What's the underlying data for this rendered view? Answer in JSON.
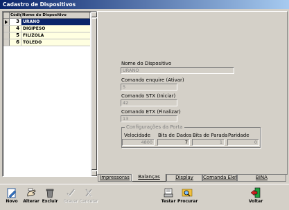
{
  "window": {
    "title": "Cadastro de Dispositivos"
  },
  "grid": {
    "headers": {
      "cod": "Códig",
      "nome": "Nome do Dispositivo"
    },
    "rows": [
      {
        "cod": "3",
        "nome": "URANO"
      },
      {
        "cod": "4",
        "nome": "DIGIPESO"
      },
      {
        "cod": "5",
        "nome": "FILIZOLA"
      },
      {
        "cod": "6",
        "nome": "TOLEDO"
      }
    ]
  },
  "form": {
    "nome_label": "Nome do Dispositivo",
    "nome_value": "URANO",
    "enquire_label": "Comando enquire (Ativar)",
    "enquire_value": "5",
    "stx_label": "Comando STX (Iniciar)",
    "stx_value": "42",
    "etx_label": "Comando ETX (Finalizar)",
    "etx_value": "13",
    "porta": {
      "legend": "Configurações da Porta",
      "velocidade_label": "Velocidade",
      "velocidade_value": "4800",
      "bits_dados_label": "Bits de Dados",
      "bits_dados_value": "7",
      "bits_parada_label": "Bits de Parada",
      "bits_parada_value": "1",
      "paridade_label": "Paridade",
      "paridade_value": "0"
    }
  },
  "tabs": [
    "Impressoras",
    "Balanças",
    "Display",
    "Comanda Elet.",
    "BINA"
  ],
  "active_tab": "Balanças",
  "toolbar": {
    "novo": "Novo",
    "alterar": "Alterar",
    "excluir": "Excluir",
    "gravar": "Gravar",
    "cancelar": "Cancelar",
    "testar": "Testar",
    "procurar": "Procurar",
    "voltar": "Voltar"
  },
  "colors": {
    "titlebar": "#0a246a",
    "selection": "#0a246a",
    "alt_row": "#ffffe1",
    "face": "#d4d0c8"
  }
}
